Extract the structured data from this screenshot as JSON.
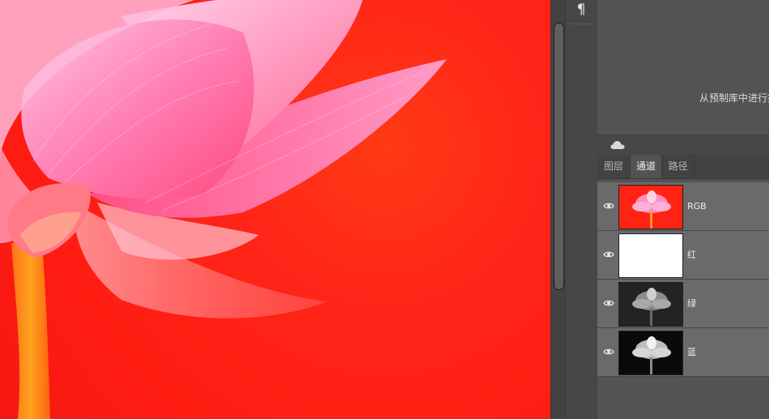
{
  "toolbar": {
    "paragraph_icon": "¶"
  },
  "libraries": {
    "message": "从预制库中进行拖"
  },
  "cloud": {
    "icon": "cloud-icon"
  },
  "panel_tabs": [
    {
      "label": "图层",
      "active": false
    },
    {
      "label": "通道",
      "active": true
    },
    {
      "label": "路径",
      "active": false
    }
  ],
  "channels": [
    {
      "name": "RGB",
      "visible": true,
      "selected": true
    },
    {
      "name": "红",
      "visible": true,
      "selected": true
    },
    {
      "name": "绿",
      "visible": true,
      "selected": true
    },
    {
      "name": "蓝",
      "visible": true,
      "selected": true
    }
  ],
  "colors": {
    "canvas_red": "#ff1d12",
    "petal_pink": "#ff5fa0",
    "panel_bg": "#535353",
    "row_selected": "#6a6a6a"
  }
}
